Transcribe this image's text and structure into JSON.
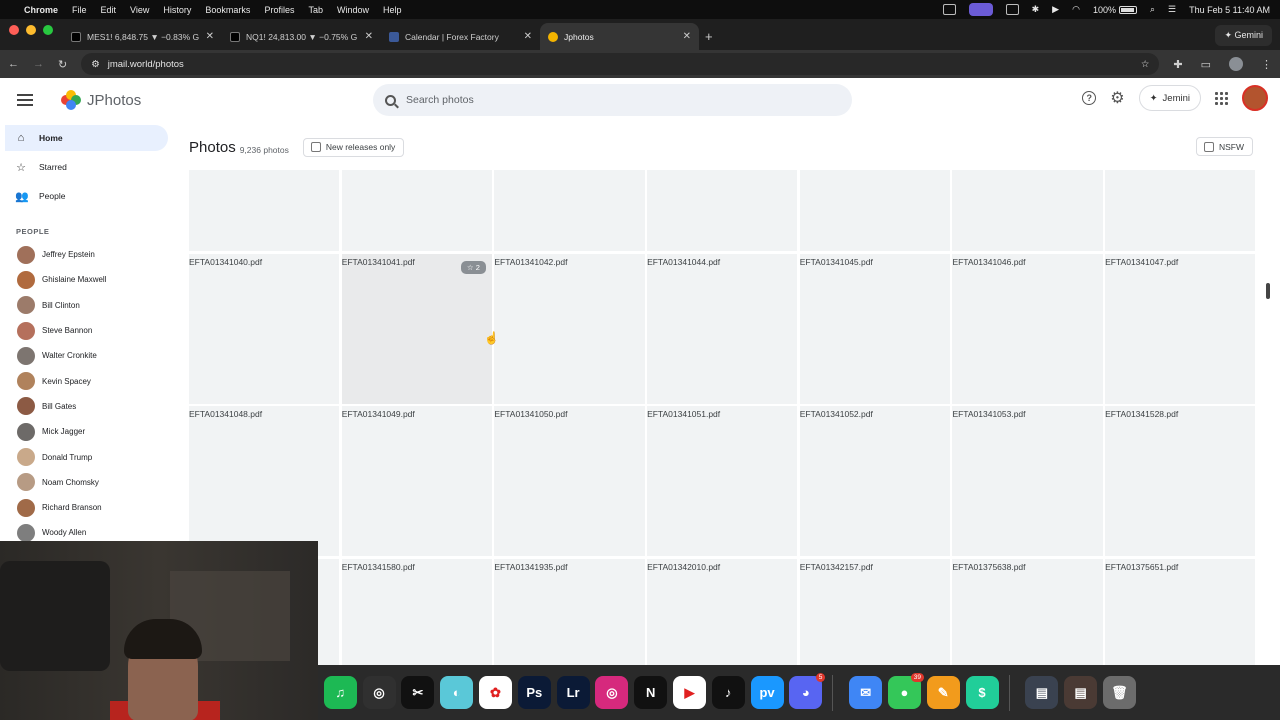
{
  "menubar": {
    "app_name": "Chrome",
    "items": [
      "File",
      "Edit",
      "View",
      "History",
      "Bookmarks",
      "Profiles",
      "Tab",
      "Window",
      "Help"
    ],
    "battery": "100%",
    "datetime": "Thu Feb 5  11:40 AM"
  },
  "tabs": [
    {
      "title": "MES1! 6,848.75 ▼ −0.83% G",
      "fav_color": "#000000"
    },
    {
      "title": "NQ1! 24,813.00 ▼ −0.75% G",
      "fav_color": "#000000"
    },
    {
      "title": "Calendar | Forex Factory",
      "fav_color": "#3b5998"
    },
    {
      "title": "Jphotos",
      "fav_color": "#f4b400"
    }
  ],
  "gemini_label": "Gemini",
  "url": "jmail.world/photos",
  "app": {
    "name": "JPhotos",
    "search_placeholder": "Search photos",
    "jemini_label": "Jemini"
  },
  "nav": [
    {
      "label": "Home",
      "icon": "home-icon"
    },
    {
      "label": "Starred",
      "icon": "star-icon"
    },
    {
      "label": "People",
      "icon": "people-icon"
    }
  ],
  "people_heading": "PEOPLE",
  "people": [
    {
      "name": "Jeffrey Epstein",
      "color": "#a0705a"
    },
    {
      "name": "Ghislaine Maxwell",
      "color": "#b06a3e"
    },
    {
      "name": "Bill Clinton",
      "color": "#9c7b6a"
    },
    {
      "name": "Steve Bannon",
      "color": "#b5705c"
    },
    {
      "name": "Walter Cronkite",
      "color": "#7d7570"
    },
    {
      "name": "Kevin Spacey",
      "color": "#b0825c"
    },
    {
      "name": "Bill Gates",
      "color": "#8c5a44"
    },
    {
      "name": "Mick Jagger",
      "color": "#6d6a68"
    },
    {
      "name": "Donald Trump",
      "color": "#c9a98a"
    },
    {
      "name": "Noam Chomsky",
      "color": "#b79b84"
    },
    {
      "name": "Richard Branson",
      "color": "#a06a48"
    },
    {
      "name": "Woody Allen",
      "color": "#7e7e7e"
    }
  ],
  "main": {
    "title": "Photos",
    "count": "9,236 photos",
    "new_releases_label": "New releases only",
    "nsfw_label": "NSFW"
  },
  "grid_rows": [
    [
      "",
      "",
      "",
      "",
      "",
      "",
      ""
    ],
    [
      "EFTA01341040.pdf",
      "EFTA01341041.pdf",
      "EFTA01341042.pdf",
      "EFTA01341044.pdf",
      "EFTA01341045.pdf",
      "EFTA01341046.pdf",
      "EFTA01341047.pdf"
    ],
    [
      "EFTA01341048.pdf",
      "EFTA01341049.pdf",
      "EFTA01341050.pdf",
      "EFTA01341051.pdf",
      "EFTA01341052.pdf",
      "EFTA01341053.pdf",
      "EFTA01341528.pdf"
    ],
    [
      "",
      "EFTA01341580.pdf",
      "EFTA01341935.pdf",
      "EFTA01342010.pdf",
      "EFTA01342157.pdf",
      "EFTA01375638.pdf",
      "EFTA01375651.pdf"
    ]
  ],
  "star_badge": "☆ 2",
  "dock": [
    {
      "icon": "spotify-icon",
      "glyph": "♫",
      "bg": "#1db954"
    },
    {
      "icon": "obs-icon",
      "glyph": "◎",
      "bg": "#303030"
    },
    {
      "icon": "capcut-icon",
      "glyph": "✂",
      "bg": "#111111"
    },
    {
      "icon": "app-icon",
      "glyph": "◐",
      "bg": "#5ac8d8"
    },
    {
      "icon": "chatgpt-icon",
      "glyph": "✿",
      "bg": "#ffffff"
    },
    {
      "icon": "photoshop-icon",
      "glyph": "Ps",
      "bg": "#0b1a36"
    },
    {
      "icon": "lightroom-icon",
      "glyph": "Lr",
      "bg": "#0b1a36"
    },
    {
      "icon": "instagram-icon",
      "glyph": "◎",
      "bg": "#d6297d"
    },
    {
      "icon": "netflix-icon",
      "glyph": "N",
      "bg": "#111111"
    },
    {
      "icon": "youtube-icon",
      "glyph": "▶",
      "bg": "#ffffff"
    },
    {
      "icon": "tiktok-icon",
      "glyph": "♪",
      "bg": "#111111"
    },
    {
      "icon": "prime-video-icon",
      "glyph": "pv",
      "bg": "#1a98ff"
    },
    {
      "icon": "discord-icon",
      "glyph": "◕",
      "bg": "#5865f2",
      "badge": "5"
    },
    {
      "icon": "sep",
      "glyph": "",
      "bg": ""
    },
    {
      "icon": "mail-icon",
      "glyph": "✉",
      "bg": "#3f86f5"
    },
    {
      "icon": "messages-icon",
      "glyph": "●",
      "bg": "#34c759",
      "badge": "39"
    },
    {
      "icon": "pages-icon",
      "glyph": "✎",
      "bg": "#f29b1c"
    },
    {
      "icon": "robinhood-icon",
      "glyph": "$",
      "bg": "#21ce99"
    },
    {
      "icon": "sep",
      "glyph": "",
      "bg": ""
    },
    {
      "icon": "folder-icon",
      "glyph": "▤",
      "bg": "#3a4250"
    },
    {
      "icon": "folder-icon",
      "glyph": "▤",
      "bg": "#4a3a34"
    },
    {
      "icon": "trash-icon",
      "glyph": "🗑",
      "bg": "#6c6c6c"
    }
  ]
}
